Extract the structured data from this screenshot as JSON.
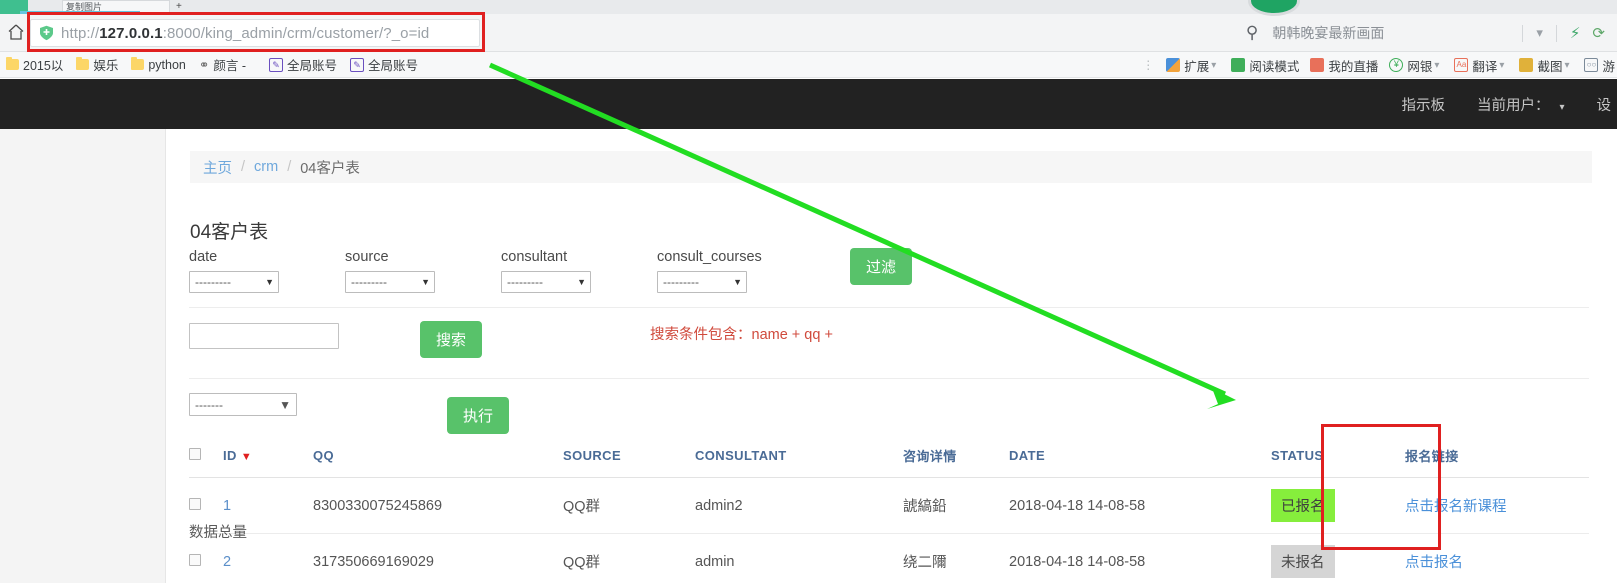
{
  "browser": {
    "tab_title": "复制图片",
    "url_display_prefix": "http://",
    "url_host": "127.0.0.1",
    "url_rest": ":8000/king_admin/crm/customer/?_o=id",
    "search_field_text": "朝韩晚宴最新画面",
    "home_icon": "home-icon",
    "shield_icon": "shield-icon",
    "sync_icon": "sync-icon",
    "bolt_icon": "bolt-icon",
    "magnifier_icon": "search-icon",
    "new_tab_label": "+"
  },
  "bookmarks": {
    "left": [
      {
        "label": "2015以",
        "icon": "folder-icon"
      },
      {
        "label": "娱乐",
        "icon": "folder-icon"
      },
      {
        "label": "python",
        "icon": "folder-icon"
      },
      {
        "label": "颜言 -",
        "icon": "person-icon"
      },
      {
        "label": "全局账号",
        "icon": "note-icon"
      },
      {
        "label": "全局账号",
        "icon": "note-icon"
      }
    ],
    "right": [
      {
        "label": "扩展",
        "icon": "grid-icon",
        "color": "#4a90d9",
        "caret": true
      },
      {
        "label": "阅读模式",
        "icon": "book-icon",
        "color": "#3fae5a",
        "caret": false
      },
      {
        "label": "我的直播",
        "icon": "calendar-icon",
        "color": "#e8705a",
        "caret": false
      },
      {
        "label": "网银",
        "icon": "yuan-icon",
        "color": "#3fae5a",
        "caret": true
      },
      {
        "label": "翻译",
        "icon": "translate-icon",
        "color": "#e8705a",
        "caret": true
      },
      {
        "label": "截图",
        "icon": "camera-icon",
        "color": "#e0b13a",
        "caret": true
      },
      {
        "label": "游",
        "icon": "game-icon",
        "color": "#7b8a99",
        "caret": false
      }
    ]
  },
  "navbar": {
    "dashboard_label": "指示板",
    "current_user_label": "当前用户：",
    "caret": "▾",
    "extra_label": "设"
  },
  "breadcrumb": {
    "home": "主页",
    "app": "crm",
    "current": "04客户表",
    "separator": "/"
  },
  "page": {
    "title": "04客户表"
  },
  "filters": {
    "items": [
      {
        "label": "date",
        "value": "---------"
      },
      {
        "label": "source",
        "value": "---------"
      },
      {
        "label": "consultant",
        "value": "---------"
      },
      {
        "label": "consult_courses",
        "value": "---------"
      }
    ],
    "button_label": "过滤"
  },
  "search": {
    "input_value": "",
    "placeholder": "",
    "button_label": "搜索",
    "hint_prefix": "搜索条件包含：",
    "hint_fields": "name + qq +"
  },
  "actions": {
    "select_value": "-------",
    "button_label": "执行"
  },
  "table": {
    "headers": [
      "",
      "ID",
      "QQ",
      "SOURCE",
      "CONSULTANT",
      "咨询详情",
      "DATE",
      "STATUS",
      "报名链接"
    ],
    "sort_column": "ID",
    "sort_indicator": "▼",
    "rows": [
      {
        "id": "1",
        "qq": "8300330075245869",
        "source": "QQ群",
        "consultant": "admin2",
        "detail": "諕縞鉛",
        "date": "2018-04-18 14-08-58",
        "status": "已报名",
        "status_style": "green",
        "link": "点击报名新课程"
      },
      {
        "id": "2",
        "qq": "317350669169029",
        "source": "QQ群",
        "consultant": "admin",
        "detail": "绕二隬",
        "date": "2018-04-18 14-08-58",
        "status": "未报名",
        "status_style": "gray",
        "link": "点击报名"
      }
    ]
  },
  "footer": {
    "partial_text": "数据总量"
  },
  "annotations": {
    "arrow_color": "#22dd22",
    "box_color": "#e02020"
  },
  "colors": {
    "accent_green": "#58c26a",
    "status_green": "#86ee3c",
    "status_gray": "#d5d5d5",
    "link_blue": "#4a90d9",
    "navbar_dark": "#222222",
    "hint_red": "#d04a3c"
  }
}
